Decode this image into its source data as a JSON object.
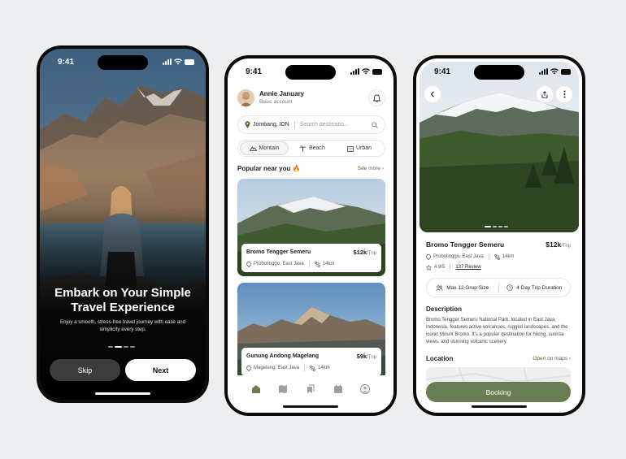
{
  "status_time": "9:41",
  "onboarding": {
    "title": "Embark on Your Simple Travel Experience",
    "subtitle": "Enjoy a smooth, stress-free travel journey with ease and simplicity every step.",
    "skip_label": "Skip",
    "next_label": "Next",
    "page_count": 4,
    "current_page": 2
  },
  "home": {
    "user_name": "Annie January",
    "user_role": "Basic account",
    "location": "Jombang, IDN",
    "search_placeholder": "Search destinatio...",
    "categories": [
      {
        "label": "Montain",
        "icon": "mountain-icon",
        "active": true
      },
      {
        "label": "Beach",
        "icon": "palm-icon",
        "active": false
      },
      {
        "label": "Urban",
        "icon": "building-icon",
        "active": false
      }
    ],
    "section_title": "Popular near you 🔥",
    "see_more": "See more",
    "cards": [
      {
        "name": "Bromo  Tengger Semeru",
        "price": "$12k",
        "unit": "/Trip",
        "location": "Probolinggo, East Java",
        "distance": "14km"
      },
      {
        "name": "Gunung Andong Magelang",
        "price": "$9k",
        "unit": "/Trip",
        "location": "Magelang, East Java",
        "distance": "14km"
      }
    ],
    "tabs": [
      "home-icon",
      "map-icon",
      "bookmark-icon",
      "calendar-icon",
      "profile-icon"
    ]
  },
  "detail": {
    "title": "Bromo  Tengger Semeru",
    "price": "$12k",
    "unit": "/Trip",
    "location": "Probolinggo, East Java",
    "distance": "14km",
    "rating": "4.9/5",
    "reviews": "137 Review",
    "feature_group": "Max 12 Grup Size",
    "feature_duration": "4 Day Trip Duration",
    "description_heading": "Description",
    "description": "Bromo Tengger Semeru National Park, located in East Java, Indonesia, features active volcanoes, rugged landscapes, and the iconic Mount Bromo. It's a popular destination for hiking, sunrise views, and stunning volcanic scenery.",
    "location_heading": "Location",
    "open_maps": "Open on maps",
    "booking_label": "Booking"
  },
  "colors": {
    "accent": "#6a7e54",
    "link": "#4d6b3a",
    "background": "#eceef0"
  }
}
